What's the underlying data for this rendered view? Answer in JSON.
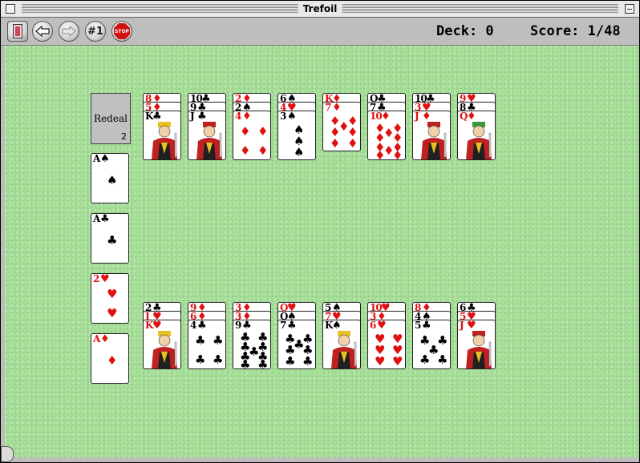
{
  "window": {
    "title": "Trefoil"
  },
  "toolbar": {
    "buttons": [
      {
        "name": "deck-button",
        "icon": "card-back-icon"
      },
      {
        "name": "back-button",
        "icon": "arrow-left-icon"
      },
      {
        "name": "forward-button",
        "icon": "arrow-right-icon",
        "disabled": true
      },
      {
        "name": "game-number-button",
        "label": "#1"
      },
      {
        "name": "stop-button",
        "label": "STOP"
      }
    ],
    "deck_text": "Deck: 0",
    "score_text": "Score: 1/48"
  },
  "redeal": {
    "label": "Redeal",
    "count": "2"
  },
  "foundations": [
    {
      "rank": "A",
      "suit": "♠",
      "color": "black"
    },
    {
      "rank": "A",
      "suit": "♣",
      "color": "black"
    },
    {
      "rank": "2",
      "suit": "♥",
      "color": "red"
    },
    {
      "rank": "A",
      "suit": "♦",
      "color": "red"
    }
  ],
  "tableau_top": [
    {
      "covered": [
        {
          "rank": "8",
          "suit": "♦"
        },
        {
          "rank": "5",
          "suit": "♦"
        }
      ],
      "top": {
        "rank": "K",
        "suit": "♣",
        "face": true
      }
    },
    {
      "covered": [
        {
          "rank": "10",
          "suit": "♣"
        },
        {
          "rank": "9",
          "suit": "♣"
        }
      ],
      "top": {
        "rank": "J",
        "suit": "♣",
        "face": true
      }
    },
    {
      "covered": [
        {
          "rank": "2",
          "suit": "♦"
        },
        {
          "rank": "2",
          "suit": "♠"
        }
      ],
      "top": {
        "rank": "4",
        "suit": "♦"
      }
    },
    {
      "covered": [
        {
          "rank": "6",
          "suit": "♠"
        },
        {
          "rank": "4",
          "suit": "♥"
        }
      ],
      "top": {
        "rank": "3",
        "suit": "♠"
      }
    },
    {
      "covered": [
        {
          "rank": "K",
          "suit": "♦"
        }
      ],
      "top": {
        "rank": "7",
        "suit": "♦"
      }
    },
    {
      "covered": [
        {
          "rank": "Q",
          "suit": "♣"
        },
        {
          "rank": "7",
          "suit": "♣"
        }
      ],
      "top": {
        "rank": "10",
        "suit": "♦"
      }
    },
    {
      "covered": [
        {
          "rank": "10",
          "suit": "♣"
        },
        {
          "rank": "3",
          "suit": "♥"
        }
      ],
      "top": {
        "rank": "J",
        "suit": "♦",
        "face": true
      }
    },
    {
      "covered": [
        {
          "rank": "9",
          "suit": "♥"
        },
        {
          "rank": "8",
          "suit": "♣"
        }
      ],
      "top": {
        "rank": "Q",
        "suit": "♦",
        "face": true
      }
    }
  ],
  "tableau_bottom": [
    {
      "covered": [
        {
          "rank": "2",
          "suit": "♣"
        },
        {
          "rank": "J",
          "suit": "♥"
        }
      ],
      "top": {
        "rank": "K",
        "suit": "♥",
        "face": true
      }
    },
    {
      "covered": [
        {
          "rank": "9",
          "suit": "♦"
        },
        {
          "rank": "6",
          "suit": "♦"
        }
      ],
      "top": {
        "rank": "4",
        "suit": "♣"
      }
    },
    {
      "covered": [
        {
          "rank": "3",
          "suit": "♦"
        },
        {
          "rank": "3",
          "suit": "♦"
        }
      ],
      "top": {
        "rank": "9",
        "suit": "♣"
      }
    },
    {
      "covered": [
        {
          "rank": "Q",
          "suit": "♥"
        },
        {
          "rank": "Q",
          "suit": "♠"
        }
      ],
      "top": {
        "rank": "7",
        "suit": "♣"
      }
    },
    {
      "covered": [
        {
          "rank": "5",
          "suit": "♠"
        },
        {
          "rank": "7",
          "suit": "♥"
        }
      ],
      "top": {
        "rank": "K",
        "suit": "♠",
        "face": true
      }
    },
    {
      "covered": [
        {
          "rank": "10",
          "suit": "♥"
        },
        {
          "rank": "3",
          "suit": "♦"
        }
      ],
      "top": {
        "rank": "6",
        "suit": "♥"
      }
    },
    {
      "covered": [
        {
          "rank": "8",
          "suit": "♦"
        },
        {
          "rank": "4",
          "suit": "♠"
        }
      ],
      "top": {
        "rank": "5",
        "suit": "♣"
      }
    },
    {
      "covered": [
        {
          "rank": "6",
          "suit": "♣"
        },
        {
          "rank": "5",
          "suit": "♥"
        }
      ],
      "top": {
        "rank": "J",
        "suit": "♥",
        "face": true
      }
    }
  ]
}
